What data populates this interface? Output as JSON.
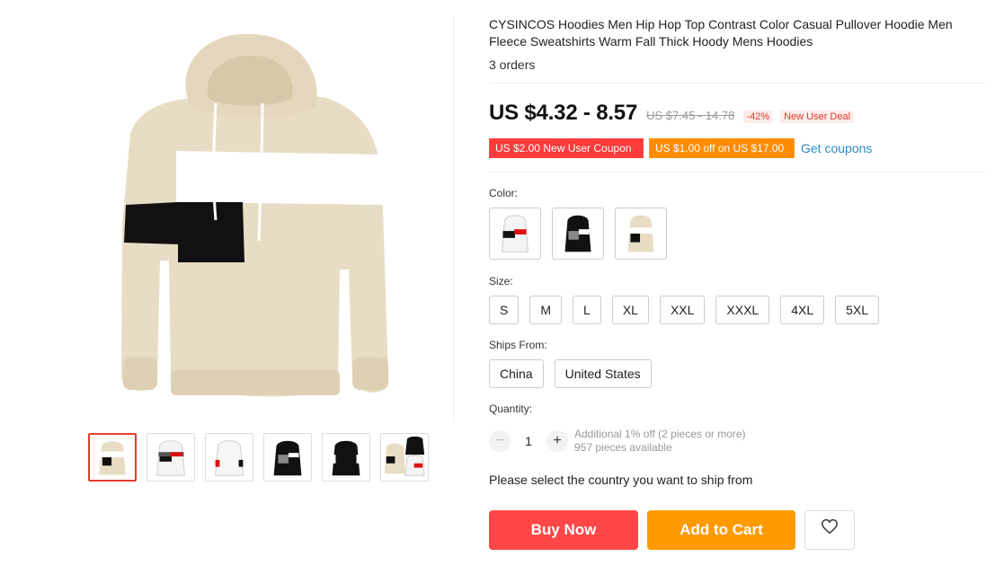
{
  "product": {
    "title": "CYSINCOS Hoodies Men Hip Hop Top Contrast Color Casual Pullover Hoodie Men Fleece Sweatshirts Warm Fall Thick Hoody Mens Hoodies",
    "orders": "3 orders"
  },
  "price": {
    "current": "US $4.32 - 8.57",
    "original": "US $7.45 - 14.78",
    "discount": "-42%",
    "deal": "New User Deal"
  },
  "coupons": {
    "red": "US $2.00 New User Coupon",
    "orange": "US $1.00 off on US $17.00",
    "link": "Get coupons"
  },
  "color": {
    "label": "Color:",
    "options": [
      "white-red",
      "black",
      "khaki"
    ]
  },
  "size": {
    "label": "Size:",
    "options": [
      "S",
      "M",
      "L",
      "XL",
      "XXL",
      "XXXL",
      "4XL",
      "5XL"
    ]
  },
  "ships_from": {
    "label": "Ships From:",
    "options": [
      "China",
      "United States"
    ]
  },
  "quantity": {
    "label": "Quantity:",
    "minus": "−",
    "value": "1",
    "plus": "+",
    "info_line1": "Additional 1% off (2 pieces or more)",
    "info_line2": "957 pieces available"
  },
  "ship_note": "Please select the country you want to ship from",
  "actions": {
    "buy_now": "Buy Now",
    "add_to_cart": "Add to Cart",
    "wishlist_icon": "heart-icon"
  },
  "colors": {
    "accent_red": "#ff4747",
    "accent_orange": "#ff9a00",
    "link_blue": "#2a8cc7",
    "hoodie_khaki": "#e8dcc4"
  }
}
